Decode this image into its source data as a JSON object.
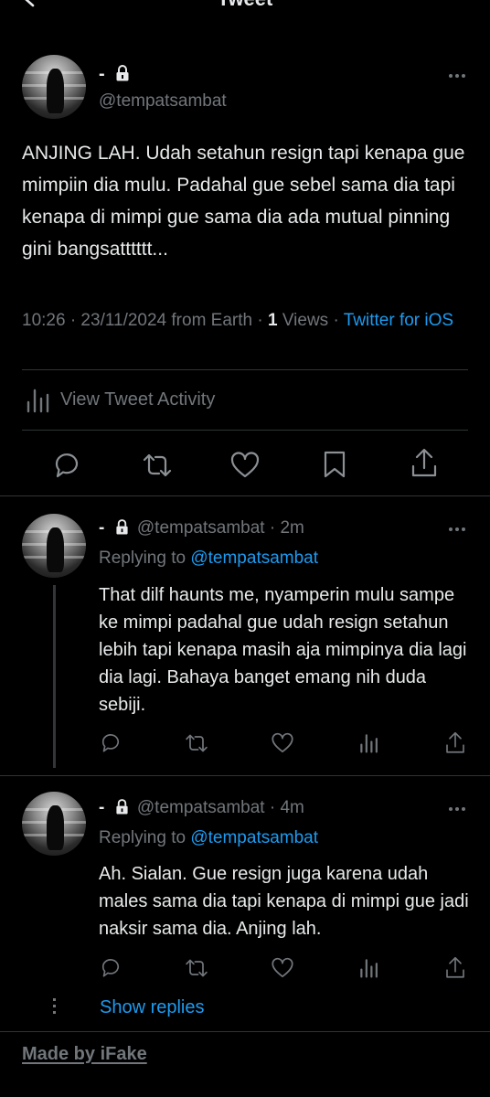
{
  "header": {
    "title": "Tweet"
  },
  "main_tweet": {
    "name": "-",
    "handle": "@tempatsambat",
    "text": "ANJING LAH. Udah setahun resign tapi kenapa gue mimpiin dia mulu. Padahal gue sebel sama dia tapi kenapa di mimpi gue sama dia ada mutual pinning gini bangsatttttt...",
    "meta_time": "10:26 · 23/11/2024 from Earth · ",
    "views_count": "1",
    "views_label": " Views · ",
    "source": "Twitter for iOS",
    "activity_label": "View Tweet Activity"
  },
  "replies": [
    {
      "name": "-",
      "handle": "@tempatsambat",
      "time": " · 2m",
      "replying_label": "Replying to ",
      "replying_to": "@tempatsambat",
      "text": "That dilf haunts me, nyamperin mulu sampe ke mimpi padahal gue udah resign setahun lebih tapi kenapa masih aja mimpinya dia lagi dia lagi. Bahaya banget emang nih duda sebiji."
    },
    {
      "name": "-",
      "handle": "@tempatsambat",
      "time": " · 4m",
      "replying_label": "Replying to ",
      "replying_to": "@tempatsambat",
      "text": "Ah. Sialan. Gue resign juga karena udah males sama dia tapi kenapa di mimpi gue jadi naksir sama dia. Anjing lah."
    }
  ],
  "show_replies": "Show replies",
  "footer": {
    "watermark": "Made by iFake"
  },
  "colors": {
    "background": "#000000",
    "text": "#e7e9ea",
    "secondary": "#71767b",
    "accent": "#1d9bf0",
    "divider": "#2f3336"
  },
  "icons": [
    "back-arrow-icon",
    "lock-icon",
    "more-icon",
    "analytics-icon",
    "reply-icon",
    "retweet-icon",
    "like-icon",
    "bookmark-icon",
    "share-icon"
  ]
}
